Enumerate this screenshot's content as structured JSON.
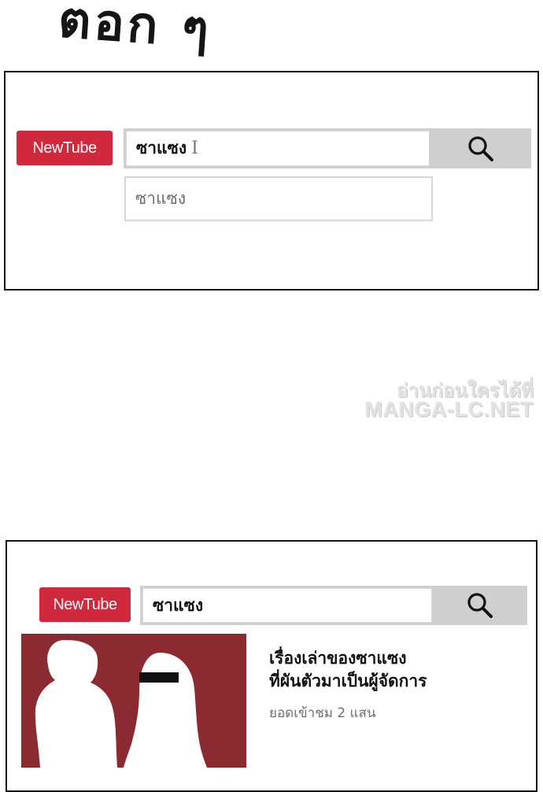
{
  "chapter_title": "ตอก ๆ",
  "panel_top": {
    "logo": "NewTube",
    "search_value": "ซาแซง",
    "caret": "I",
    "suggestion": "ซาแซง"
  },
  "watermark": {
    "line1": "อ่านก่อนใครได้ที่",
    "line2": "MANGA-LC.NET"
  },
  "panel_bottom": {
    "logo": "NewTube",
    "search_value": "ซาแซง",
    "video": {
      "title_line1": "เรื่องเล่าของซาแซง",
      "title_line2": "ที่ผันตัวมาเป็นผู้จัดการ",
      "views": "ยอดเข้าชม 2 แสน"
    }
  },
  "colors": {
    "logo_bg": "#d0283c",
    "search_bar_bg": "#cfcfcf",
    "thumbnail_bg": "#8b2a31",
    "silhouette": "#ffffff"
  },
  "icons": [
    "search-icon",
    "text-cursor-icon"
  ]
}
